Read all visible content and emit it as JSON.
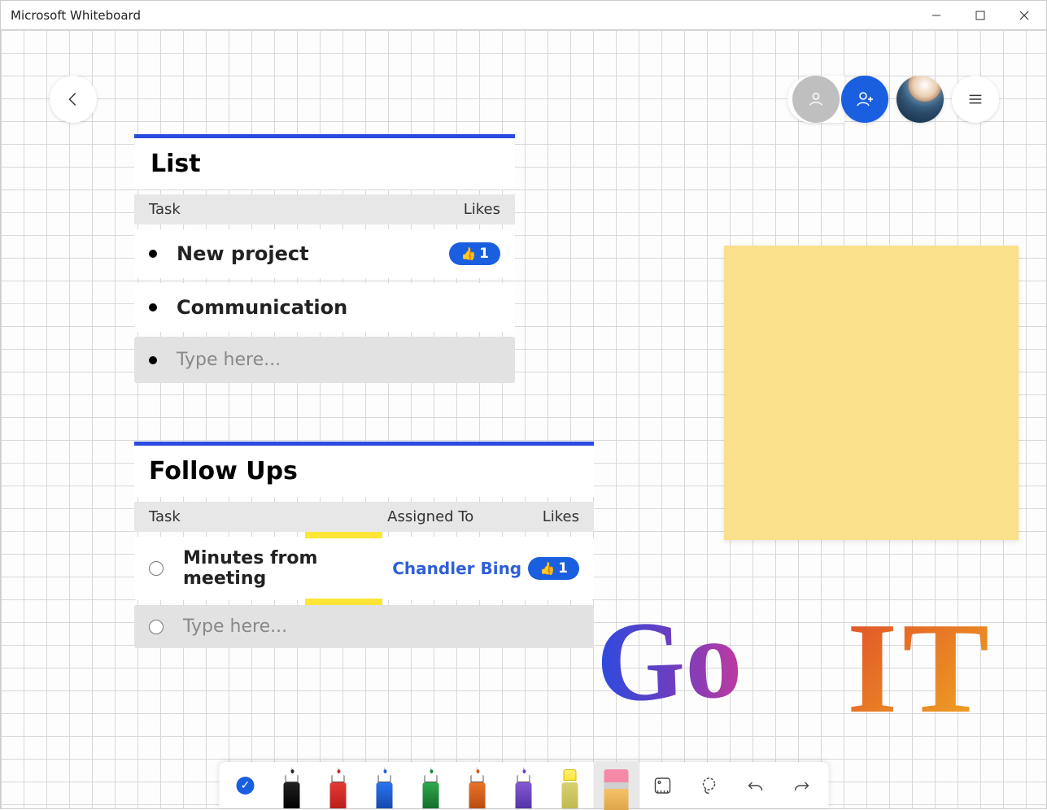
{
  "window": {
    "title": "Microsoft Whiteboard"
  },
  "list_card": {
    "title": "List",
    "columns": {
      "task": "Task",
      "likes": "Likes"
    },
    "rows": [
      {
        "text": "New project",
        "likes": "1"
      },
      {
        "text": "Communication"
      }
    ],
    "placeholder": "Type here..."
  },
  "followups_card": {
    "title": "Follow Ups",
    "columns": {
      "task": "Task",
      "assigned": "Assigned To",
      "likes": "Likes"
    },
    "rows": [
      {
        "text": "Minutes from meeting",
        "assigned": "Chandler Bing",
        "likes": "1"
      }
    ],
    "placeholder": "Type here..."
  },
  "ink": {
    "go": "Go",
    "it": "IT"
  },
  "sticky_note": {
    "text": ""
  },
  "toolbar_tools": {
    "select": "select-mode",
    "pens": [
      "black",
      "red",
      "blue",
      "green",
      "orange",
      "purple",
      "highlighter"
    ],
    "eraser": "eraser",
    "ruler": "ruler",
    "lasso": "lasso",
    "undo": "undo",
    "redo": "redo"
  }
}
